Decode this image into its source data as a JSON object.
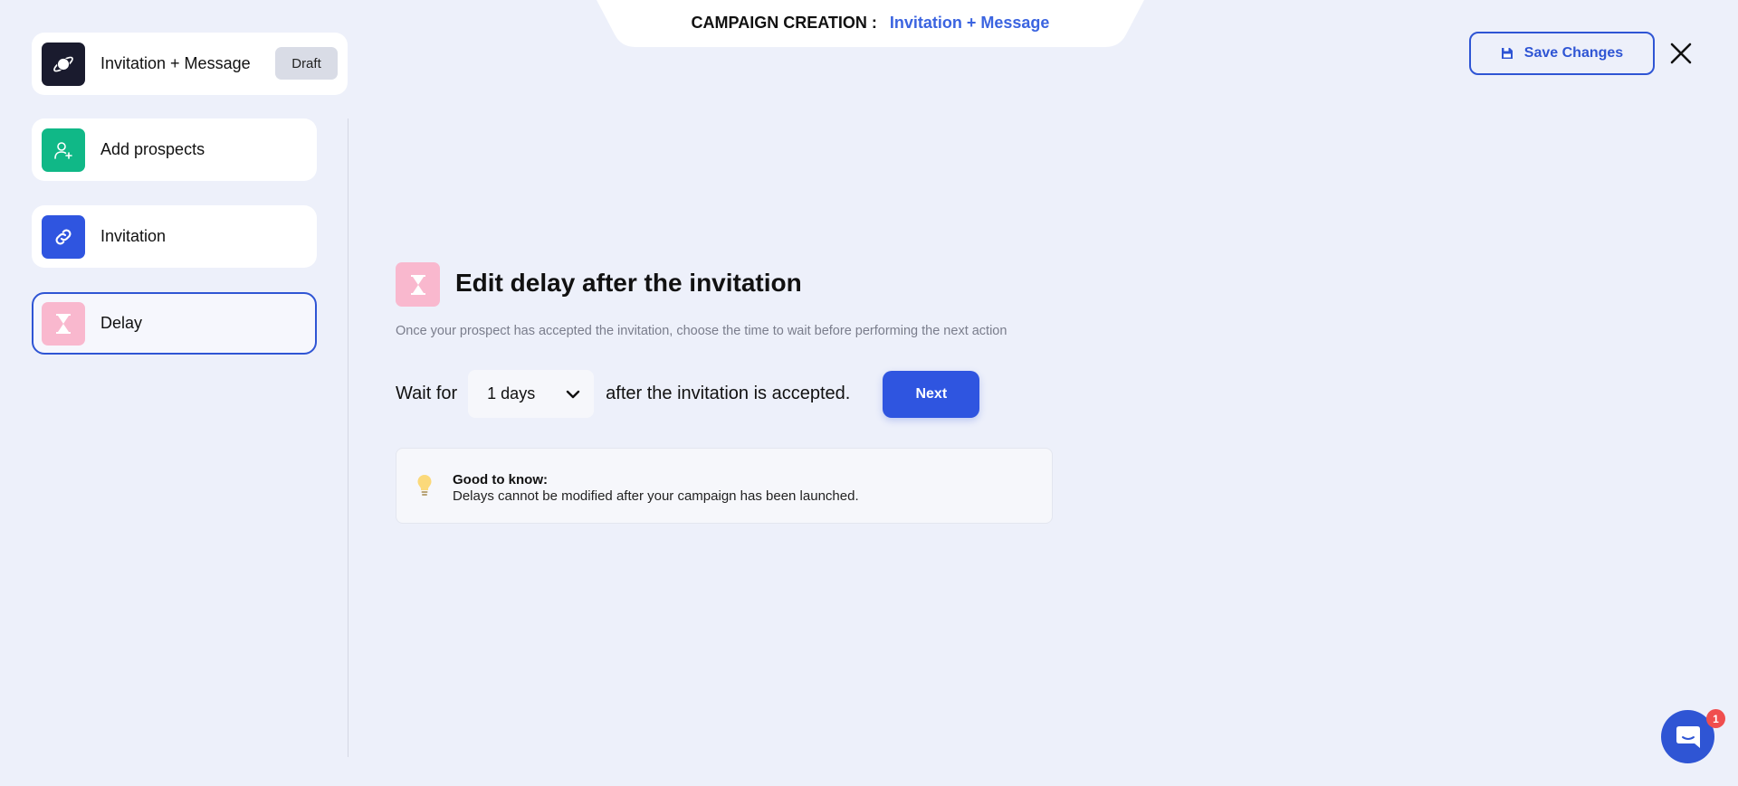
{
  "header": {
    "label": "CAMPAIGN CREATION :",
    "campaign_name": "Invitation + Message",
    "save_label": "Save Changes"
  },
  "sidebar": {
    "items": [
      {
        "label": "Invitation + Message",
        "badge": "Draft",
        "icon": "planet-icon",
        "color": "#1a1b2e"
      },
      {
        "label": "Add prospects",
        "icon": "add-user-icon",
        "color": "#10b887"
      },
      {
        "label": "Invitation",
        "icon": "link-icon",
        "color": "#2f55e0"
      },
      {
        "label": "Delay",
        "icon": "hourglass-icon",
        "color": "#f9b8ce",
        "active": true
      }
    ]
  },
  "main": {
    "title": "Edit delay after the invitation",
    "subtitle": "Once your prospect has accepted the invitation, choose the time to wait before performing the next action",
    "wait_prefix": "Wait for",
    "delay_value": "1 days",
    "wait_suffix": "after the invitation is accepted.",
    "next_label": "Next",
    "info_title": "Good to know:",
    "info_body": "Delays cannot be modified after your campaign has been launched."
  },
  "chat": {
    "badge_count": "1"
  },
  "colors": {
    "accent": "#2f55e0",
    "background": "#edf0fa",
    "alert": "#f04e4e"
  }
}
